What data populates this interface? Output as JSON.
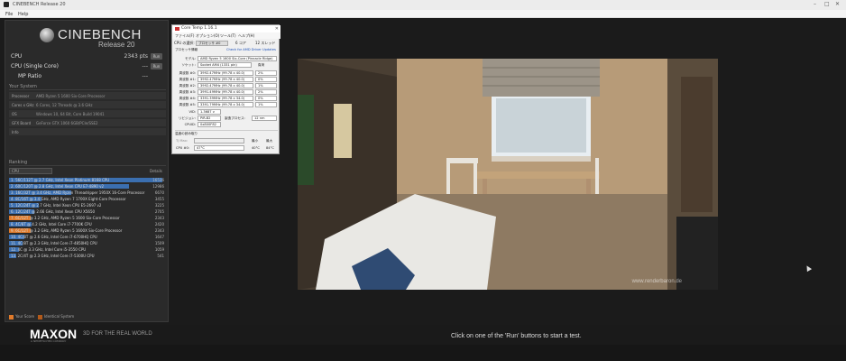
{
  "window": {
    "title": "CINEBENCH Release 20"
  },
  "menu": {
    "file": "File",
    "help": "Help"
  },
  "logo": {
    "name": "CINEBENCH",
    "release": "Release 20"
  },
  "scores": [
    {
      "label": "CPU",
      "value": "2343 pts",
      "button": "Run"
    },
    {
      "label": "CPU (Single Core)",
      "value": "---",
      "button": "Run"
    },
    {
      "label": "MP Ratio",
      "value": "---",
      "button": ""
    }
  ],
  "your_system": {
    "header": "Your System",
    "rows": [
      {
        "key": "Processor",
        "value": "AMD Ryzen 5 1600 Six-Core Processor"
      },
      {
        "key": "Cores x GHz",
        "value": "6 Cores, 12 Threads @ 3.6 GHz"
      },
      {
        "key": "OS",
        "value": "Windows 10, 64 Bit, Core Build 19041"
      },
      {
        "key": "GFX Board",
        "value": "GeForce GTX 1060 6GB/PCIe/SSE2"
      },
      {
        "key": "Info",
        "value": ""
      }
    ]
  },
  "ranking": {
    "header": "Ranking",
    "select": "CPU",
    "details": "Details",
    "items": [
      {
        "label": "1. 56C/112T @ 2.7 GHz, Intel Xeon Platinum 8168 CPU",
        "score": "16536",
        "fraction": 1.0,
        "mine": false
      },
      {
        "label": "2. 60C/120T @ 2.8 GHz, Intel Xeon CPU E7-4890 v2",
        "score": "12986",
        "fraction": 0.785,
        "mine": false
      },
      {
        "label": "3. 16C/32T @ 3.4 GHz, AMD Ryzen Threadripper 1950X 16-Core Processor",
        "score": "6670",
        "fraction": 0.403,
        "mine": false
      },
      {
        "label": "4. 8C/16T @ 3.4 GHz, AMD Ryzen 7 1700X Eight-Core Processor",
        "score": "3455",
        "fraction": 0.209,
        "mine": false
      },
      {
        "label": "5. 12C/24T @ 2.7 GHz, Intel Xeon CPU E5-2697 v2",
        "score": "3225",
        "fraction": 0.195,
        "mine": false
      },
      {
        "label": "6. 12C/24T @ 2.66 GHz, Intel Xeon CPU X5650",
        "score": "2705",
        "fraction": 0.164,
        "mine": false
      },
      {
        "label": "7. 6C/12T @ 3.2 GHz, AMD Ryzen 5 1600 Six-Core Processor",
        "score": "2343",
        "fraction": 0.142,
        "mine": true
      },
      {
        "label": "8. 4C/8T @ 4.2 GHz, Intel Core i7-7700K CPU",
        "score": "2420",
        "fraction": 0.146,
        "mine": false
      },
      {
        "label": "9. 6C/12T @ 3.2 GHz, AMD Ryzen 5 1600X Six-Core Processor",
        "score": "2343",
        "fraction": 0.142,
        "mine": true
      },
      {
        "label": "10. 4C/8T @ 2.6 GHz, Intel Core i7-6700HQ CPU",
        "score": "1647",
        "fraction": 0.1,
        "mine": false
      },
      {
        "label": "11. 4C/8T @ 2.3 GHz, Intel Core i7-4850HQ CPU",
        "score": "1509",
        "fraction": 0.091,
        "mine": false
      },
      {
        "label": "12. 4C @ 3.3 GHz, Intel Core i5-3550 CPU",
        "score": "1059",
        "fraction": 0.064,
        "mine": false
      },
      {
        "label": "13. 2C/4T @ 2.3 GHz, Intel Core i7-5300U CPU",
        "score": "541",
        "fraction": 0.033,
        "mine": false
      }
    ]
  },
  "legend": {
    "your_score": "Your Score",
    "identical": "Identical System"
  },
  "footer": {
    "brand": "MAXON",
    "brand_sub": "A NEMETSCHEK COMPANY",
    "tagline": "3D FOR THE REAL WORLD",
    "status": "Click on one of the 'Run' buttons to start a test."
  },
  "render": {
    "watermark": "www.renderbaron.de"
  },
  "coretemp": {
    "title": "Core Temp 1.16.1",
    "menu": [
      "ファイル(F)",
      "オプション(O)",
      "ツール(T)",
      "ヘルプ(H)"
    ],
    "cpu_select_label": "CPU の選択:",
    "cpu_select_value": "プロセッサ #0",
    "cores_label": "6 コア",
    "threads_label": "12 スレッド",
    "proc_info_header": "プロセッサ情報",
    "update_link": "Check for AMD Driver Updates",
    "model_label": "モデル:",
    "model_value": "AMD Ryzen 5 1600 Six-Core (Pinnacle Ridge)",
    "socket_label": "ソケット:",
    "socket_value": "Socket AM4 (1331 pin)",
    "socket_extra": "負荷",
    "freqs": [
      {
        "label": "周波数 #0:",
        "value": "3992.47MHz (99.78 x 40.0)",
        "load": "2%"
      },
      {
        "label": "周波数 #1:",
        "value": "3992.47MHz (99.78 x 40.0)",
        "load": "0%"
      },
      {
        "label": "周波数 #2:",
        "value": "3992.47MHz (99.78 x 40.0)",
        "load": "1%"
      },
      {
        "label": "周波数 #3:",
        "value": "3991.49MHz (99.78 x 40.0)",
        "load": "2%"
      },
      {
        "label": "周波数 #4:",
        "value": "3391.39MHz (99.78 x 34.0)",
        "load": "0%"
      },
      {
        "label": "周波数 #5:",
        "value": "3391.79MHz (99.78 x 34.0)",
        "load": "1%"
      }
    ],
    "vid_label": "VID:",
    "vid_value": "1.3687 v",
    "revision_label": "リビジョン:",
    "revision_value": "PiR-B2",
    "lithography_label": "製造プロセス:",
    "lithography_value": "12 nm",
    "cpuid_label": "CPUID:",
    "cpuid_value": "0x800F82",
    "temp_header": "温度の読み取り",
    "tj_label": "TJ Max:",
    "min_label": "最小",
    "max_label": "最大",
    "cpu_temp_label": "CPU #0:",
    "cpu_temp_value": "47°C",
    "cpu_temp_min": "40°C",
    "cpu_temp_max": "84°C"
  },
  "colors": {
    "accent": "#3b6fb0",
    "mine": "#e07a2a"
  }
}
